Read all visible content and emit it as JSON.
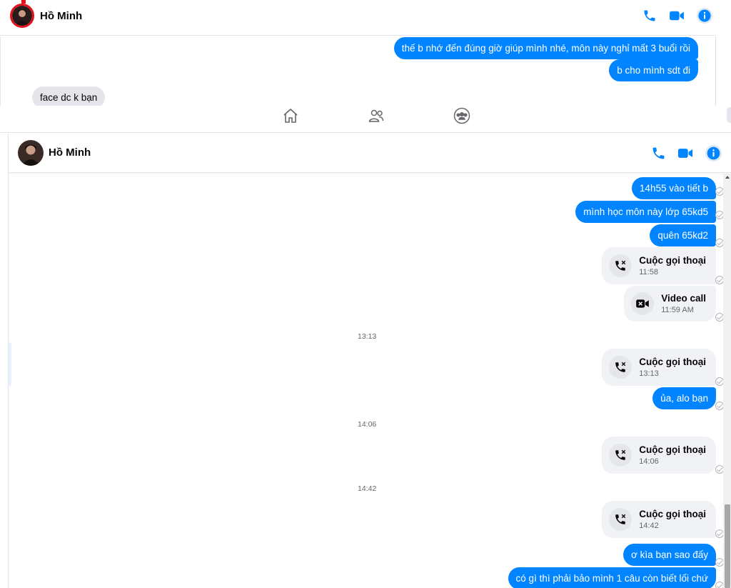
{
  "colors": {
    "accent": "#0084ff",
    "incoming_bubble": "#e4e6eb",
    "call_card": "#f0f2f5",
    "avatar_ring": "#e4111b"
  },
  "top_window": {
    "contact_name": "Hồ Minh",
    "header_icons": [
      "phone-icon",
      "video-camera-icon",
      "info-icon"
    ],
    "messages": [
      {
        "direction": "out",
        "text": "thế b nhớ đến đúng giờ giúp mình nhé, môn này nghỉ mất 3 buổi rồi"
      },
      {
        "direction": "out",
        "text": "b cho mình sdt đi"
      },
      {
        "direction": "in",
        "text": "face dc k bạn"
      }
    ],
    "tab_icons": [
      "home-icon",
      "friends-icon",
      "groups-icon"
    ]
  },
  "main_window": {
    "contact_name": "Hồ Minh",
    "header_icons": [
      "phone-icon",
      "video-camera-icon",
      "info-icon"
    ],
    "messages": [
      {
        "type": "text",
        "text": "14h55 vào tiết b"
      },
      {
        "type": "text",
        "text": "mình học môn này lớp 65kd5"
      },
      {
        "type": "text",
        "text": "quên 65kd2"
      },
      {
        "type": "call",
        "icon": "missed-call-icon",
        "title": "Cuộc gọi thoại",
        "time": "11:58"
      },
      {
        "type": "call",
        "icon": "missed-video-icon",
        "title": "Video call",
        "time": "11:59 AM"
      },
      {
        "type": "separator",
        "text": "13:13"
      },
      {
        "type": "call",
        "icon": "missed-call-icon",
        "title": "Cuộc gọi thoại",
        "time": "13:13"
      },
      {
        "type": "text",
        "text": "ủa, alo bạn"
      },
      {
        "type": "separator",
        "text": "14:06"
      },
      {
        "type": "call",
        "icon": "missed-call-icon",
        "title": "Cuộc gọi thoại",
        "time": "14:06"
      },
      {
        "type": "separator",
        "text": "14:42"
      },
      {
        "type": "call",
        "icon": "missed-call-icon",
        "title": "Cuộc gọi thoại",
        "time": "14:42"
      },
      {
        "type": "text",
        "text": "ơ kìa bạn sao đấy"
      },
      {
        "type": "text",
        "text": "có gì thì phải bảo mình 1 câu còn biết lối chứ"
      }
    ]
  }
}
